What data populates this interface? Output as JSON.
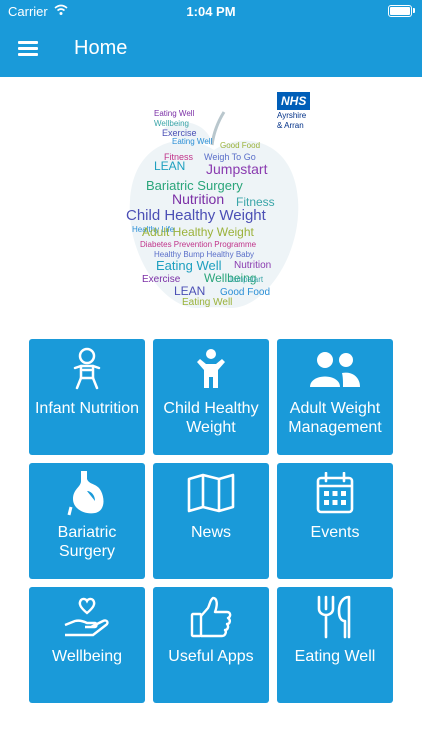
{
  "status_bar": {
    "carrier": "Carrier",
    "time": "1:04 PM"
  },
  "header": {
    "title": "Home",
    "menu_icon": "hamburger-menu-icon"
  },
  "logo": {
    "org": "NHS",
    "region_line1": "Ayrshire",
    "region_line2": "& Arran"
  },
  "wordcloud": {
    "words": [
      "Eating Well",
      "Wellbeing",
      "Exercise",
      "Eating Well",
      "Good Food",
      "Fitness",
      "Weigh To Go",
      "LEAN",
      "Jumpstart",
      "Bariatric Surgery",
      "Nutrition",
      "Fitness",
      "Child Healthy Weight",
      "Healthy Life",
      "Adult Healthy Weight",
      "Diabetes Prevention Programme",
      "Healthy Bump Healthy Baby",
      "Eating Well",
      "Nutrition",
      "Wellbeing",
      "Exercise",
      "Jumpstart",
      "LEAN",
      "Good Food",
      "Eating Well"
    ]
  },
  "tiles": [
    {
      "label": "Infant Nutrition",
      "icon": "baby-icon"
    },
    {
      "label": "Child Healthy Weight",
      "icon": "child-icon"
    },
    {
      "label": "Adult Weight Management",
      "icon": "users-icon"
    },
    {
      "label": "Bariatric Surgery",
      "icon": "stomach-icon"
    },
    {
      "label": "News",
      "icon": "map-icon"
    },
    {
      "label": "Events",
      "icon": "calendar-icon"
    },
    {
      "label": "Wellbeing",
      "icon": "heart-hand-icon"
    },
    {
      "label": "Useful Apps",
      "icon": "thumbs-up-icon"
    },
    {
      "label": "Eating Well",
      "icon": "utensils-icon"
    }
  ],
  "colors": {
    "primary": "#1a9ad9",
    "nhs_blue": "#005eb8"
  }
}
